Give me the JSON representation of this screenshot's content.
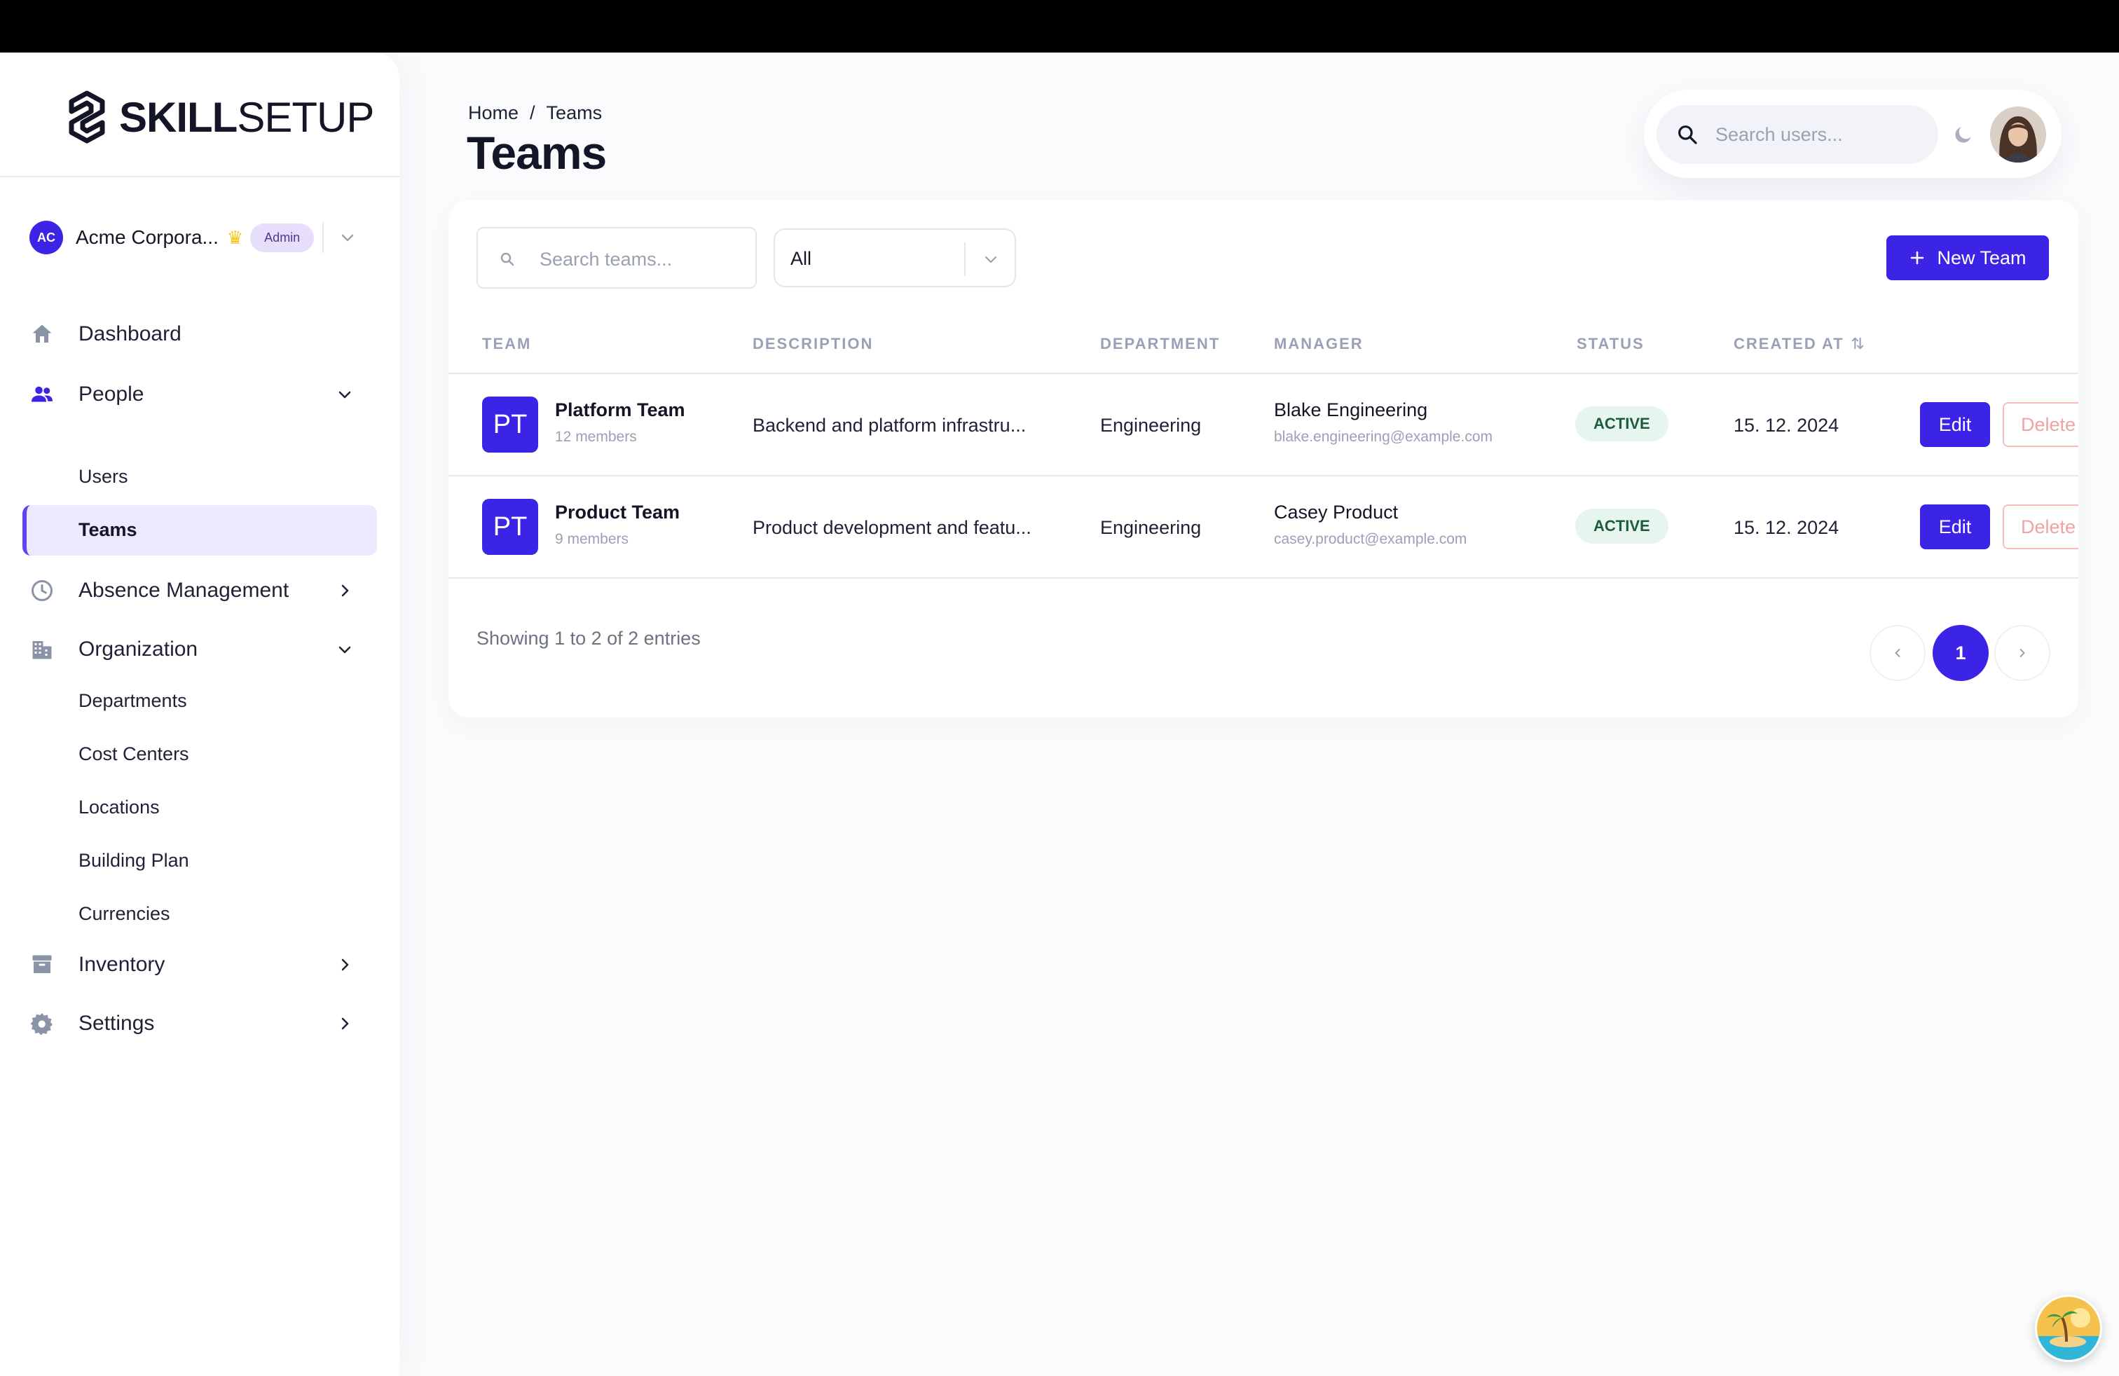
{
  "brand": {
    "bold": "SKILL",
    "light": "SETUP"
  },
  "org": {
    "initials": "AC",
    "name": "Acme Corpora...",
    "role_badge": "Admin"
  },
  "nav": {
    "dashboard": "Dashboard",
    "people": "People",
    "users": "Users",
    "teams": "Teams",
    "absence": "Absence Management",
    "organization": "Organization",
    "departments": "Departments",
    "cost_centers": "Cost Centers",
    "locations": "Locations",
    "building_plan": "Building Plan",
    "currencies": "Currencies",
    "inventory": "Inventory",
    "settings": "Settings"
  },
  "header": {
    "breadcrumb_home": "Home",
    "breadcrumb_sep": "/",
    "breadcrumb_current": "Teams",
    "title": "Teams",
    "search_placeholder": "Search users..."
  },
  "toolbar": {
    "search_placeholder": "Search teams...",
    "filter_value": "All",
    "new_team_label": "New Team"
  },
  "table": {
    "columns": [
      "TEAM",
      "DESCRIPTION",
      "DEPARTMENT",
      "MANAGER",
      "STATUS",
      "CREATED AT"
    ],
    "rows": [
      {
        "initials": "PT",
        "name": "Platform Team",
        "members": "12 members",
        "description": "Backend and platform infrastru...",
        "department": "Engineering",
        "manager": "Blake Engineering",
        "manager_email": "blake.engineering@example.com",
        "status": "ACTIVE",
        "created_at": "15. 12. 2024",
        "edit": "Edit",
        "delete": "Delete"
      },
      {
        "initials": "PT",
        "name": "Product Team",
        "members": "9 members",
        "description": "Product development and featu...",
        "department": "Engineering",
        "manager": "Casey Product",
        "manager_email": "casey.product@example.com",
        "status": "ACTIVE",
        "created_at": "15. 12. 2024",
        "edit": "Edit",
        "delete": "Delete"
      }
    ]
  },
  "footer": {
    "showing": "Showing 1 to 2 of 2 entries",
    "current_page": "1"
  },
  "colors": {
    "accent": "#3b24e6",
    "active_bg": "#ece8fd",
    "status_bg": "#e6f6ef"
  }
}
